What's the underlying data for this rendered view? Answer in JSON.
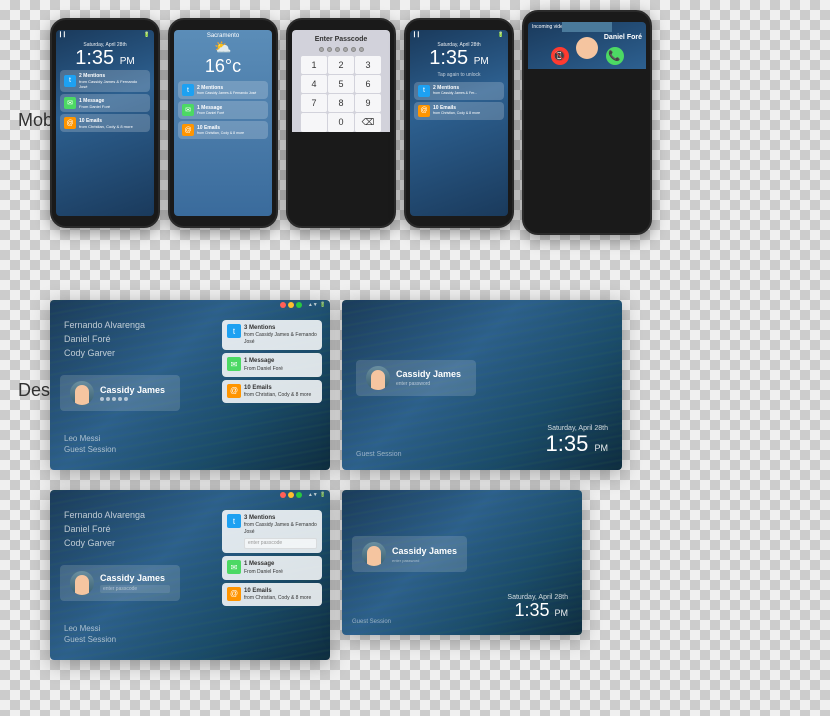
{
  "sections": {
    "mobile_label": "Mobile",
    "desktop_label": "Desktop"
  },
  "mobile": {
    "phones": [
      {
        "type": "lockscreen",
        "day": "Saturday, April 28th",
        "time": "1:35",
        "ampm": "PM",
        "notifications": [
          {
            "type": "twitter",
            "title": "2 Mentions",
            "body": "from Cassidy James & Fernando José"
          },
          {
            "type": "message",
            "title": "1 Message",
            "body": "From Daniel Foré"
          },
          {
            "type": "email",
            "title": "10 Emails",
            "body": "from Christian, Cody & 8 more"
          }
        ]
      },
      {
        "type": "weather",
        "city": "Sacramento",
        "temp": "16°c"
      },
      {
        "type": "passcode",
        "title": "Enter Passcode",
        "keys": [
          "1",
          "2",
          "3",
          "4",
          "5",
          "6",
          "7",
          "8",
          "9",
          "",
          "0",
          "⌫"
        ]
      },
      {
        "type": "lockscreen2",
        "day": "Saturday, April 28th",
        "time": "1:35",
        "ampm": "PM"
      },
      {
        "type": "call",
        "caller": "Daniel Foré"
      }
    ]
  },
  "desktop": {
    "users": [
      "Fernando Alvarenga",
      "Daniel Foré",
      "Cody Garver"
    ],
    "active_user": "Cassidy James",
    "footer_users": [
      "Leo Messi",
      "Guest Session"
    ],
    "notifications": [
      {
        "type": "twitter",
        "title": "3 Mentions",
        "body": "from Cassidy James & Fernando José"
      },
      {
        "type": "message",
        "title": "1 Message",
        "body": "From Daniel Foré"
      },
      {
        "type": "email",
        "title": "10 Emails",
        "body": "from Christian, Cody & 8 more"
      }
    ],
    "day": "Saturday, April 28th",
    "time": "1:35",
    "ampm": "PM"
  }
}
